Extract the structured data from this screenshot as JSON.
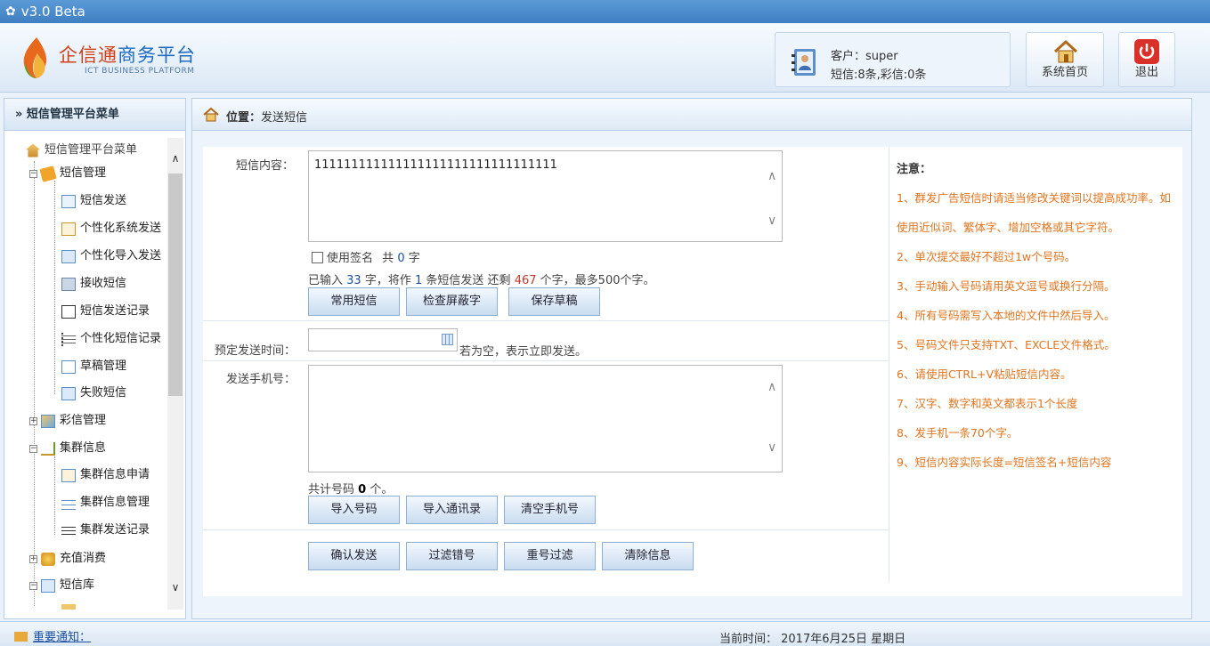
{
  "window": {
    "title": "v3.0  Beta"
  },
  "header": {
    "logo_cn_a": "企信通",
    "logo_cn_b": "商务平台",
    "logo_en": "ICT BUSINESS PLATFORM",
    "customer": "客户：super",
    "balance": "短信:8条,彩信:0条",
    "home_label": "系统首页",
    "exit_label": "退出"
  },
  "sidebar": {
    "header": "» 短信管理平台菜单",
    "items": [
      {
        "label": "短信管理平台菜单",
        "icon": "home-icon"
      },
      {
        "label": "短信管理",
        "icon": "folder-icon"
      },
      {
        "label": "短信发送",
        "icon": "mail-icon"
      },
      {
        "label": "个性化系统发送",
        "icon": "edit-icon"
      },
      {
        "label": "个性化导入发送",
        "icon": "import-icon"
      },
      {
        "label": "接收短信",
        "icon": "inbox-icon"
      },
      {
        "label": "短信发送记录",
        "icon": "record-icon"
      },
      {
        "label": "个性化短信记录",
        "icon": "list-icon"
      },
      {
        "label": "草稿管理",
        "icon": "draft-icon"
      },
      {
        "label": "失败短信",
        "icon": "fail-icon"
      },
      {
        "label": "彩信管理",
        "icon": "image-icon"
      },
      {
        "label": "集群信息",
        "icon": "cluster-icon"
      },
      {
        "label": "集群信息申请",
        "icon": "apply-icon"
      },
      {
        "label": "集群信息管理",
        "icon": "manage-icon"
      },
      {
        "label": "集群发送记录",
        "icon": "list-icon"
      },
      {
        "label": "充值消费",
        "icon": "money-icon"
      },
      {
        "label": "短信库",
        "icon": "library-icon"
      }
    ]
  },
  "breadcrumb": {
    "prefix": "位置：",
    "current": "发送短信"
  },
  "form": {
    "content_label": "短信内容：",
    "content_value": "111111111111111111111111111111111",
    "use_sign": "使用签名",
    "sign_total_prefix": "共",
    "sign_count": "0",
    "sign_total_suffix": "字",
    "typed_prefix": "已输入",
    "typed_count": "33",
    "typed_mid1": "字，将作",
    "msg_count": "1",
    "typed_mid2": "条短信发送 还剩",
    "remain_count": "467",
    "typed_suffix": "个字，最多500个字。",
    "btn_common": "常用短信",
    "btn_check": "检查屏蔽字",
    "btn_save": "保存草稿",
    "schedule_label": "预定发送时间：",
    "schedule_value": "",
    "schedule_hint": "若为空，表示立即发送。",
    "phone_label": "发送手机号：",
    "phone_total_prefix": "共计号码",
    "phone_count": "0",
    "phone_total_suffix": "个。",
    "btn_import": "导入号码",
    "btn_import_contacts": "导入通讯录",
    "btn_clear_phone": "清空手机号",
    "btn_confirm": "确认发送",
    "btn_filter_wrong": "过滤错号",
    "btn_filter_dup": "重号过滤",
    "btn_clear_info": "清除信息"
  },
  "notes": {
    "title": "注意：",
    "lines": [
      "1、群发广告短信时请适当修改关键词以提高成功率。如",
      "使用近似词、繁体字、增加空格或其它字符。",
      "2、单次提交最好不超过1w个号码。",
      "3、手动输入号码请用英文逗号或换行分隔。",
      "4、所有号码需写入本地的文件中然后导入。",
      "5、号码文件只支持TXT、EXCLE文件格式。",
      "6、请使用CTRL+V粘贴短信内容。",
      "7、汉字、数字和英文都表示1个长度",
      "8、发手机一条70个字。",
      "9、短信内容实际长度=短信签名+短信内容"
    ]
  },
  "footer": {
    "notice": "重要通知：",
    "time": "当前时间： 2017年6月25日 星期日"
  }
}
